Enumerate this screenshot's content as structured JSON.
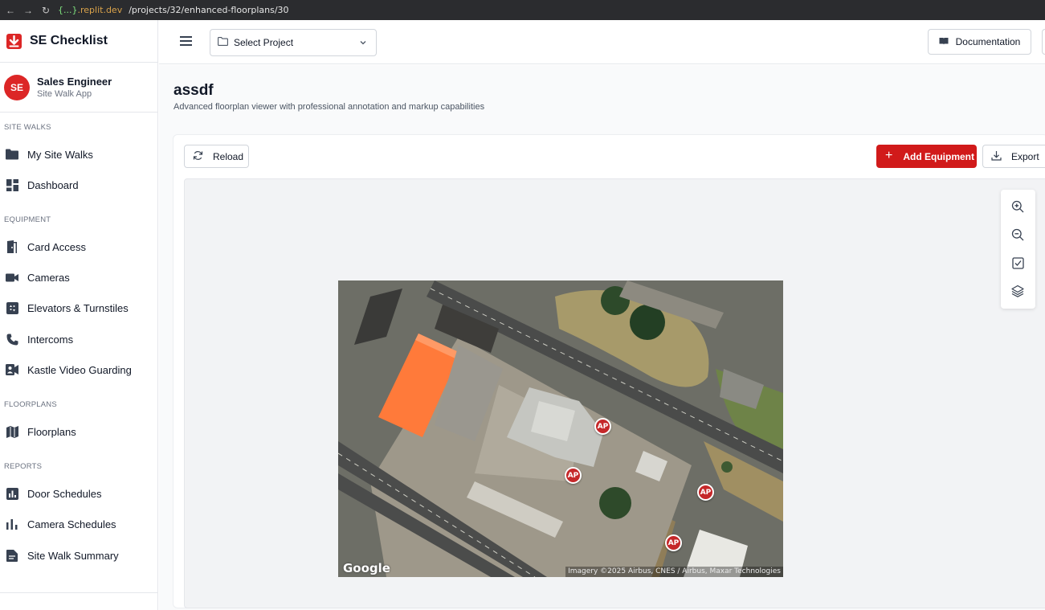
{
  "browser": {
    "host_a": "{...}",
    "host_b": ".replit.dev",
    "path": "/projects/32/enhanced-floorplans/30"
  },
  "app": {
    "name": "SE Checklist",
    "accent": "#dc2626"
  },
  "user": {
    "initials": "SE",
    "name": "Sales Engineer",
    "subtitle": "Site Walk App"
  },
  "sidebar": {
    "sections": [
      {
        "label": "SITE WALKS"
      },
      {
        "label": "EQUIPMENT"
      },
      {
        "label": "FLOORPLANS"
      },
      {
        "label": "REPORTS"
      }
    ],
    "items": [
      {
        "label": "My Site Walks",
        "icon": "folder-icon"
      },
      {
        "label": "Dashboard",
        "icon": "dashboard-icon"
      },
      {
        "label": "Card Access",
        "icon": "door-icon"
      },
      {
        "label": "Cameras",
        "icon": "camera-icon"
      },
      {
        "label": "Elevators & Turnstiles",
        "icon": "elevator-icon"
      },
      {
        "label": "Intercoms",
        "icon": "phone-icon"
      },
      {
        "label": "Kastle Video Guarding",
        "icon": "video-guard-icon"
      },
      {
        "label": "Floorplans",
        "icon": "map-icon"
      },
      {
        "label": "Door Schedules",
        "icon": "bar-chart-icon"
      },
      {
        "label": "Camera Schedules",
        "icon": "bar-chart-icon"
      },
      {
        "label": "Site Walk Summary",
        "icon": "document-icon"
      }
    ]
  },
  "topbar": {
    "project_select": "Select Project",
    "documentation": "Documentation"
  },
  "page": {
    "title": "assdf",
    "subtitle": "Advanced floorplan viewer with professional annotation and markup capabilities"
  },
  "toolbar": {
    "reload": "Reload",
    "add_equipment": "Add Equipment",
    "export": "Export"
  },
  "viewer_tools": [
    "zoom-in-icon",
    "zoom-out-icon",
    "checkbox-icon",
    "layers-icon"
  ],
  "map": {
    "logo": "Google",
    "attribution": "Imagery ©2025 Airbus, CNES / Airbus, Maxar Technologies",
    "markers": [
      {
        "label": "AP"
      },
      {
        "label": "AP"
      },
      {
        "label": "AP"
      },
      {
        "label": "AP"
      }
    ]
  }
}
